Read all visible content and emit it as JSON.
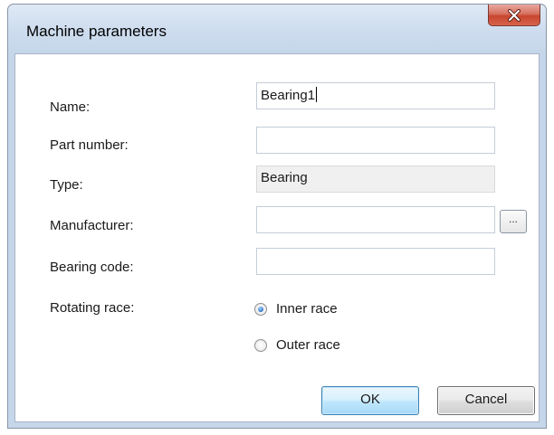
{
  "window": {
    "title": "Machine parameters"
  },
  "form": {
    "name": {
      "label": "Name:",
      "value": "Bearing1"
    },
    "part_number": {
      "label": "Part number:",
      "value": ""
    },
    "type": {
      "label": "Type:",
      "value": "Bearing"
    },
    "manufacturer": {
      "label": "Manufacturer:",
      "value": "",
      "browse_label": "..."
    },
    "bearing_code": {
      "label": "Bearing code:",
      "value": ""
    },
    "rotating_race": {
      "label": "Rotating race:",
      "options": [
        {
          "label": "Inner race",
          "checked": true
        },
        {
          "label": "Outer race",
          "checked": false
        }
      ]
    }
  },
  "buttons": {
    "ok": "OK",
    "cancel": "Cancel"
  },
  "icons": {
    "close": "close-icon"
  }
}
